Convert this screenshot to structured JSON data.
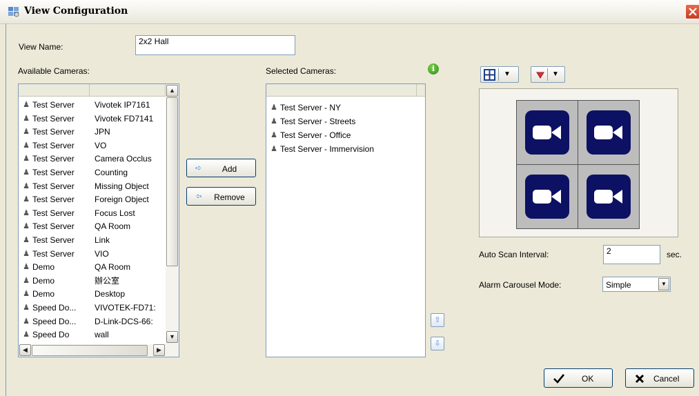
{
  "window": {
    "title": "View Configuration"
  },
  "view_name": {
    "label": "View Name:",
    "value": "2x2 Hall"
  },
  "available": {
    "label": "Available Cameras:",
    "rows": [
      [
        "Test Server",
        "Vivotek IP7161"
      ],
      [
        "Test Server",
        "Vivotek FD7141"
      ],
      [
        "Test Server",
        "JPN"
      ],
      [
        "Test Server",
        "VO"
      ],
      [
        "Test Server",
        "Camera Occlus"
      ],
      [
        "Test Server",
        "Counting"
      ],
      [
        "Test Server",
        "Missing Object"
      ],
      [
        "Test Server",
        "Foreign Object"
      ],
      [
        "Test Server",
        "Focus Lost"
      ],
      [
        "Test Server",
        "QA Room"
      ],
      [
        "Test Server",
        "Link"
      ],
      [
        "Test Server",
        "VIO"
      ],
      [
        "Demo",
        "QA Room"
      ],
      [
        "Demo",
        "辦公室"
      ],
      [
        "Demo",
        "Desktop"
      ],
      [
        "Speed Do...",
        "VIVOTEK-FD71:"
      ],
      [
        "Speed Do...",
        "D-Link-DCS-66:"
      ],
      [
        "Speed Do",
        "wall"
      ]
    ]
  },
  "buttons": {
    "add": "Add",
    "remove": "Remove",
    "ok": "OK",
    "cancel": "Cancel"
  },
  "selected": {
    "label": "Selected Cameras:",
    "rows": [
      "Test Server - NY",
      "Test Server - Streets",
      "Test Server - Office",
      "Test Server - Immervision"
    ]
  },
  "layout": {
    "grid": "2x2"
  },
  "auto_scan": {
    "label": "Auto Scan Interval:",
    "value": "2",
    "unit": "sec."
  },
  "alarm": {
    "label": "Alarm Carousel Mode:",
    "value": "Simple"
  },
  "colors": {
    "camera_tile": "#0d1163",
    "cell_bg": "#bdbdbd",
    "accent": "#4a8ede"
  }
}
